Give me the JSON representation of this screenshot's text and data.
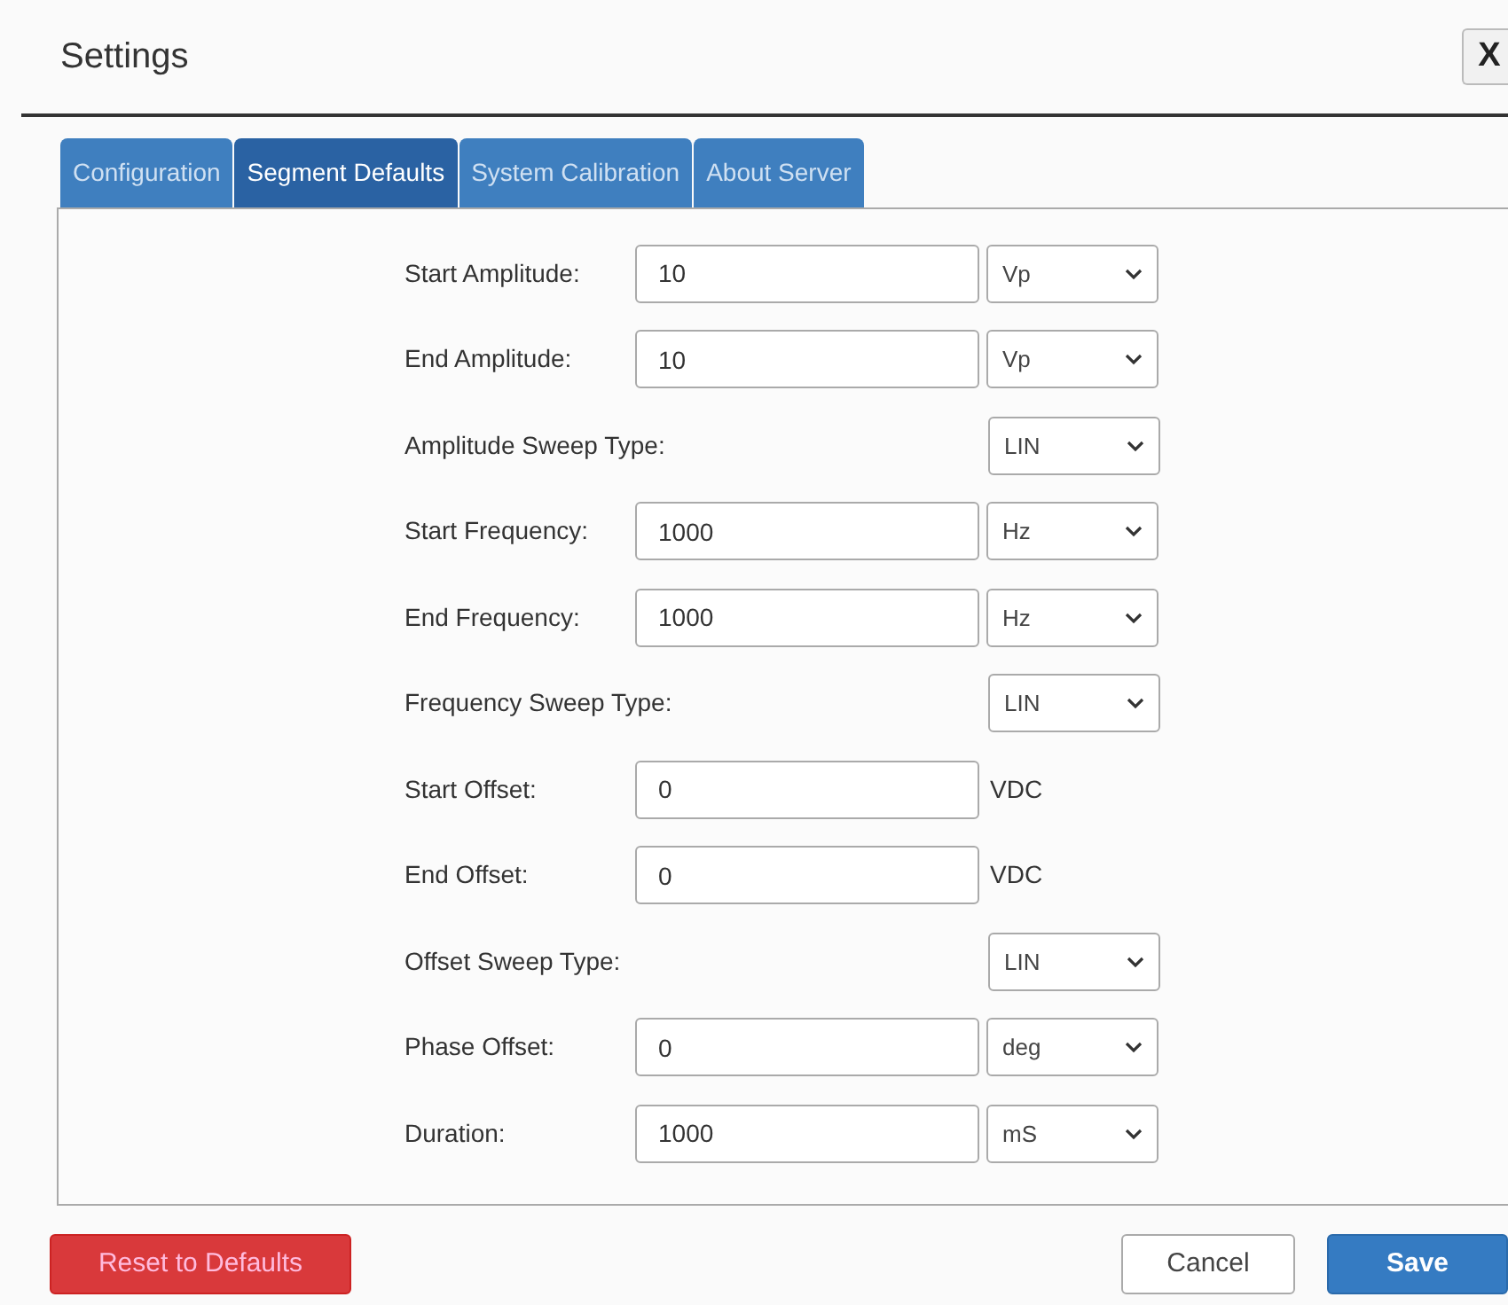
{
  "window": {
    "title": "Settings",
    "close": "X"
  },
  "tabs": [
    {
      "label": "Configuration",
      "selected": false
    },
    {
      "label": "Segment Defaults",
      "selected": true
    },
    {
      "label": "System Calibration",
      "selected": false
    },
    {
      "label": "About Server",
      "selected": false
    }
  ],
  "fields": [
    {
      "kind": "input_select",
      "label": "Start Amplitude:",
      "value": "10",
      "unit": "Vp"
    },
    {
      "kind": "input_select",
      "label": "End Amplitude:",
      "value": "10",
      "unit": "Vp"
    },
    {
      "kind": "select",
      "label": "Amplitude Sweep Type:",
      "unit": "LIN"
    },
    {
      "kind": "input_select",
      "label": "Start Frequency:",
      "value": "1000",
      "unit": "Hz"
    },
    {
      "kind": "input_select",
      "label": "End Frequency:",
      "value": "1000",
      "unit": "Hz"
    },
    {
      "kind": "select",
      "label": "Frequency Sweep Type:",
      "unit": "LIN"
    },
    {
      "kind": "input_text",
      "label": "Start Offset:",
      "value": "0",
      "unit": "VDC"
    },
    {
      "kind": "input_text",
      "label": "End Offset:",
      "value": "0",
      "unit": "VDC"
    },
    {
      "kind": "select",
      "label": "Offset Sweep Type:",
      "unit": "LIN"
    },
    {
      "kind": "input_select",
      "label": "Phase Offset:",
      "value": "0",
      "unit": "deg"
    },
    {
      "kind": "input_select",
      "label": "Duration:",
      "value": "1000",
      "unit": "mS"
    }
  ],
  "buttons": [
    {
      "kind": "danger",
      "label": "Reset to Defaults"
    },
    {
      "kind": "default",
      "label": "Cancel"
    },
    {
      "kind": "primary",
      "label": "Save"
    }
  ]
}
